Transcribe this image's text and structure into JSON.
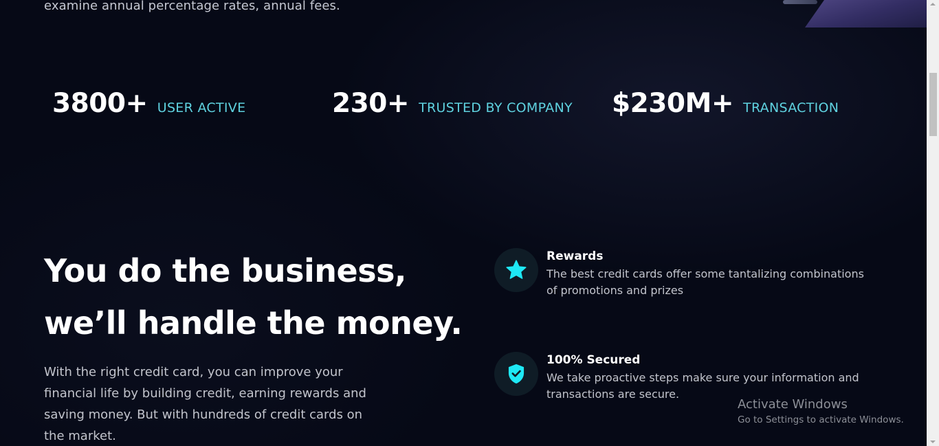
{
  "intro": {
    "text": "examine annual percentage rates, annual fees."
  },
  "stats": [
    {
      "value": "3800+",
      "label": "USER ACTIVE"
    },
    {
      "value": "230+",
      "label": "TRUSTED BY COMPANY"
    },
    {
      "value": "$230M+",
      "label": "TRANSACTION"
    }
  ],
  "hero": {
    "headline_line1": "You do the business,",
    "headline_line2": "we’ll handle the money.",
    "body": "With the right credit card, you can improve your financial life by building credit, earning rewards and saving money. But with hundreds of credit cards on the market."
  },
  "features": [
    {
      "icon": "star-icon",
      "title": "Rewards",
      "description": "The best credit cards offer some tantalizing combinations of promotions and prizes"
    },
    {
      "icon": "shield-check-icon",
      "title": "100% Secured",
      "description": "We take proactive steps make sure your information and transactions are secure."
    }
  ],
  "watermark": {
    "title": "Activate Windows",
    "subtitle": "Go to Settings to activate Windows."
  },
  "colors": {
    "background": "#060916",
    "accent": "#5fd2e0",
    "icon_accent": "#1ee8f5",
    "text_primary": "#ffffff",
    "text_secondary": "#c2c4cc"
  }
}
